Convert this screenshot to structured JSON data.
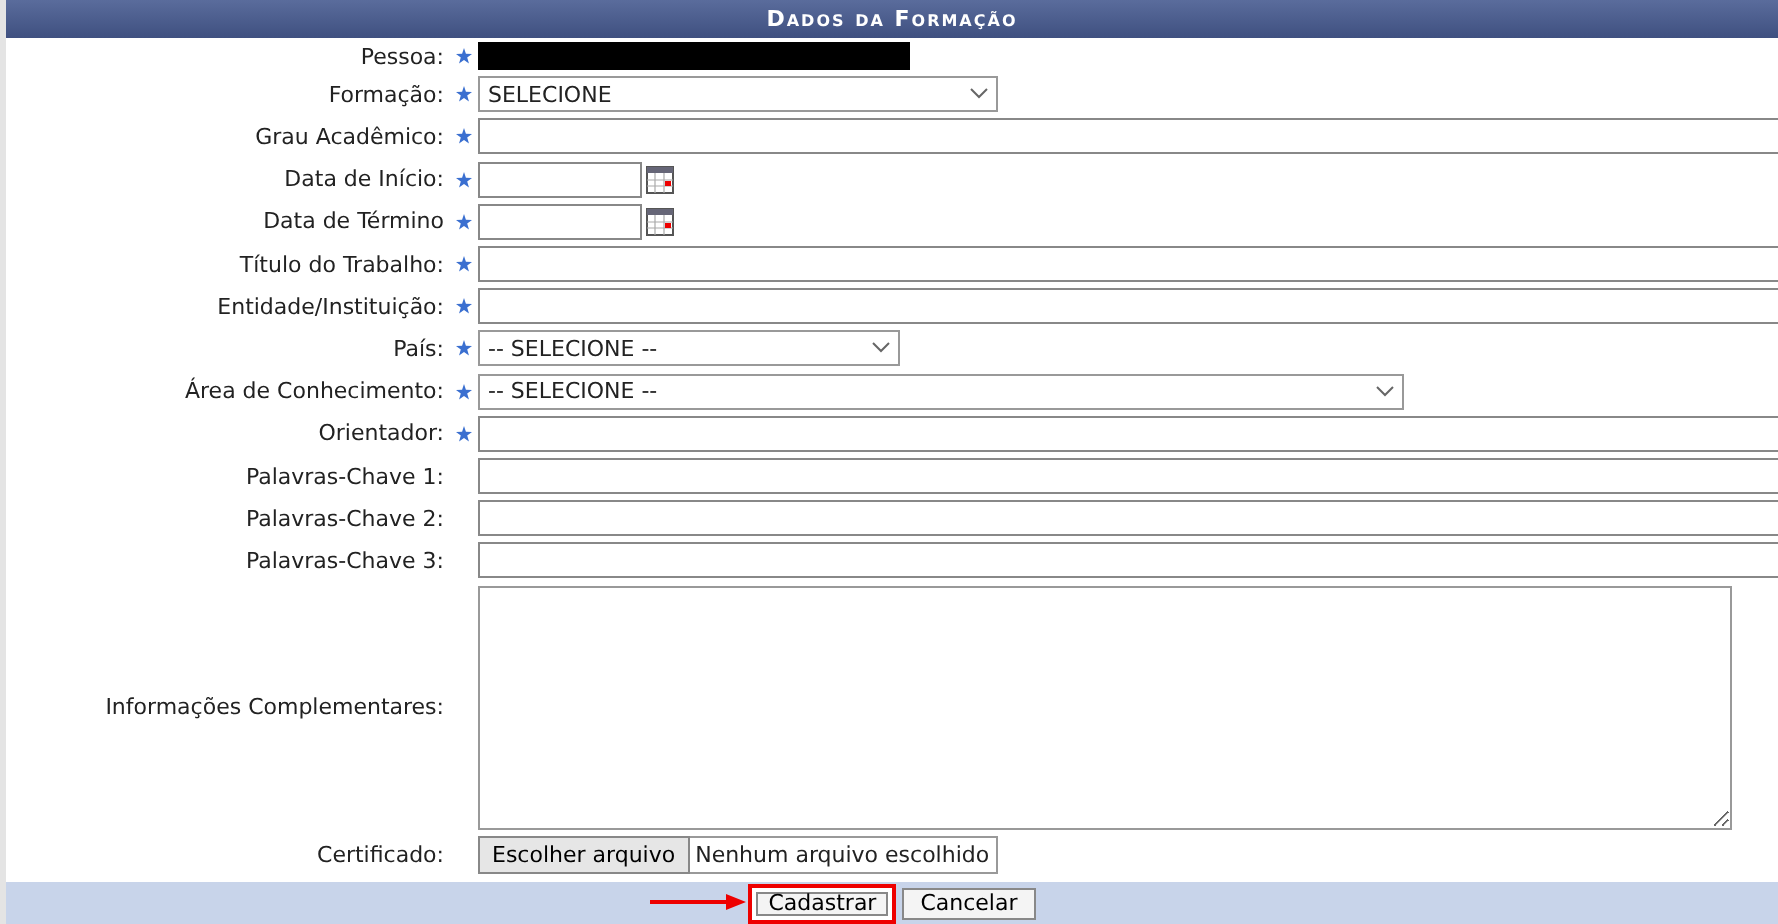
{
  "title": "Dados da Formação",
  "fields": [
    {
      "label": "Pessoa:",
      "required": true,
      "kind": "redacted"
    },
    {
      "label": "Formação:",
      "required": true,
      "kind": "select",
      "value": "SELECIONE"
    },
    {
      "label": "Grau Acadêmico:",
      "required": true,
      "kind": "text"
    },
    {
      "label": "Data de Início:",
      "required": true,
      "kind": "date"
    },
    {
      "label": "Data de Término",
      "required": true,
      "kind": "date"
    },
    {
      "label": "Título do Trabalho:",
      "required": true,
      "kind": "text"
    },
    {
      "label": "Entidade/Instituição:",
      "required": true,
      "kind": "text"
    },
    {
      "label": "País:",
      "required": true,
      "kind": "select",
      "value": "-- SELECIONE --"
    },
    {
      "label": "Área de Conhecimento:",
      "required": true,
      "kind": "select",
      "value": "-- SELECIONE --"
    },
    {
      "label": "Orientador:",
      "required": true,
      "kind": "text"
    },
    {
      "label": "Palavras-Chave 1:",
      "required": false,
      "kind": "text"
    },
    {
      "label": "Palavras-Chave 2:",
      "required": false,
      "kind": "text"
    },
    {
      "label": "Palavras-Chave 3:",
      "required": false,
      "kind": "text"
    },
    {
      "label": "Informações Complementares:",
      "required": false,
      "kind": "textarea"
    },
    {
      "label": "Certificado:",
      "required": false,
      "kind": "file",
      "button": "Escolher arquivo",
      "status": "Nenhum arquivo escolhido"
    }
  ],
  "buttons": [
    {
      "label": "Cadastrar",
      "highlighted": true
    },
    {
      "label": "Cancelar",
      "highlighted": false
    }
  ]
}
